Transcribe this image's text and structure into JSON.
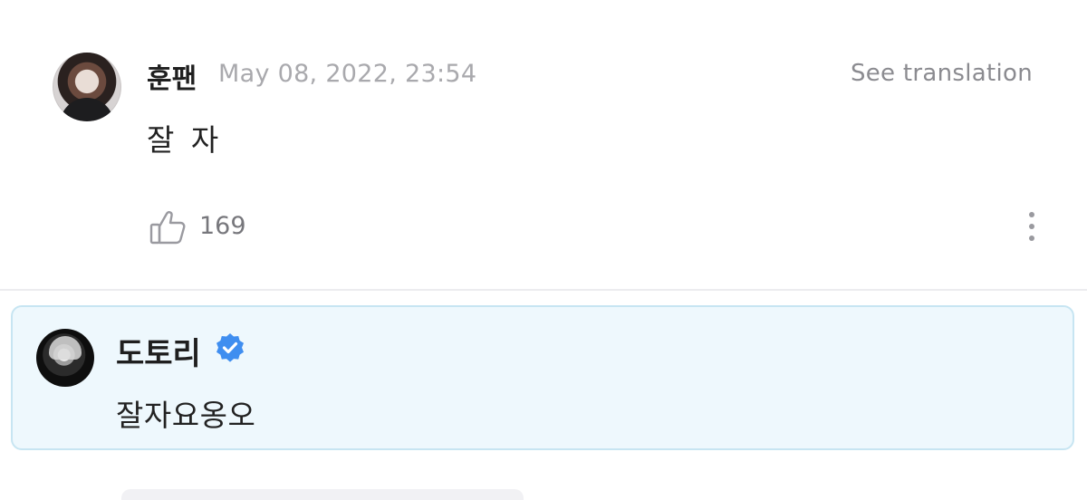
{
  "fan_comment": {
    "author": "훈팬",
    "timestamp": "May 08, 2022, 23:54",
    "translate_label": "See translation",
    "text": "잘 자",
    "like_count": "169",
    "icons": {
      "like": "thumbs-up-icon",
      "more": "more-vertical-icon"
    }
  },
  "artist_reply": {
    "author": "도토리",
    "verified": true,
    "text": "잘자요옹오",
    "colors": {
      "background": "#eef8fd",
      "border": "#c7e5f2",
      "verified_badge": "#3f8ef0"
    },
    "icons": {
      "badge": "verified-badge-icon"
    }
  }
}
